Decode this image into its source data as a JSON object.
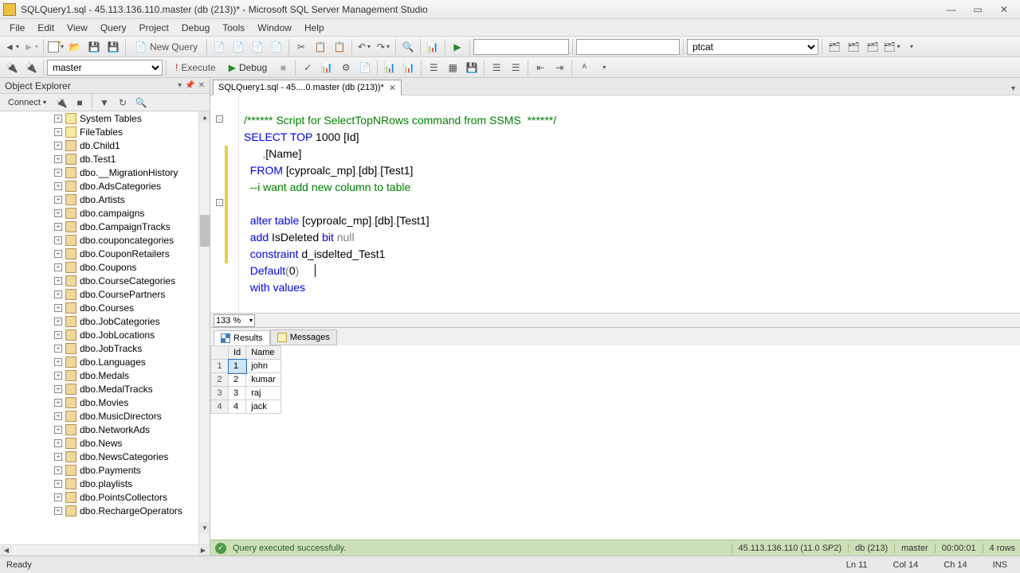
{
  "window": {
    "title": "SQLQuery1.sql - 45.113.136.110.master (db (213))* - Microsoft SQL Server Management Studio"
  },
  "menu": [
    "File",
    "Edit",
    "View",
    "Query",
    "Project",
    "Debug",
    "Tools",
    "Window",
    "Help"
  ],
  "toolbar1": {
    "new_query": "New Query",
    "combo_user": "ptcat"
  },
  "toolbar2": {
    "db_selector": "master",
    "execute": "Execute",
    "debug": "Debug"
  },
  "object_explorer": {
    "title": "Object Explorer",
    "connect": "Connect",
    "nodes": [
      {
        "t": "folder",
        "label": "System Tables"
      },
      {
        "t": "folder",
        "label": "FileTables"
      },
      {
        "t": "table",
        "label": "db.Child1"
      },
      {
        "t": "table",
        "label": "db.Test1"
      },
      {
        "t": "table",
        "label": "dbo.__MigrationHistory"
      },
      {
        "t": "table",
        "label": "dbo.AdsCategories"
      },
      {
        "t": "table",
        "label": "dbo.Artists"
      },
      {
        "t": "table",
        "label": "dbo.campaigns"
      },
      {
        "t": "table",
        "label": "dbo.CampaignTracks"
      },
      {
        "t": "table",
        "label": "dbo.couponcategories"
      },
      {
        "t": "table",
        "label": "dbo.CouponRetailers"
      },
      {
        "t": "table",
        "label": "dbo.Coupons"
      },
      {
        "t": "table",
        "label": "dbo.CourseCategories"
      },
      {
        "t": "table",
        "label": "dbo.CoursePartners"
      },
      {
        "t": "table",
        "label": "dbo.Courses"
      },
      {
        "t": "table",
        "label": "dbo.JobCategories"
      },
      {
        "t": "table",
        "label": "dbo.JobLocations"
      },
      {
        "t": "table",
        "label": "dbo.JobTracks"
      },
      {
        "t": "table",
        "label": "dbo.Languages"
      },
      {
        "t": "table",
        "label": "dbo.Medals"
      },
      {
        "t": "table",
        "label": "dbo.MedalTracks"
      },
      {
        "t": "table",
        "label": "dbo.Movies"
      },
      {
        "t": "table",
        "label": "dbo.MusicDirectors"
      },
      {
        "t": "table",
        "label": "dbo.NetworkAds"
      },
      {
        "t": "table",
        "label": "dbo.News"
      },
      {
        "t": "table",
        "label": "dbo.NewsCategories"
      },
      {
        "t": "table",
        "label": "dbo.Payments"
      },
      {
        "t": "table",
        "label": "dbo.playlists"
      },
      {
        "t": "table",
        "label": "dbo.PointsCollectors"
      },
      {
        "t": "table",
        "label": "dbo.RechargeOperators"
      }
    ]
  },
  "tab": {
    "label": "SQLQuery1.sql - 45....0.master (db (213))*"
  },
  "sql": {
    "l1": "/****** Script for SelectTopNRows command from SSMS  ******/",
    "l2a": "SELECT",
    "l2b": "TOP",
    "l2c": "1000",
    "l2d": "[Id]",
    "l3a": ",",
    "l3b": "[Name]",
    "l4a": "FROM",
    "l4b": "[cyproalc_mp]",
    "l4c": ".",
    "l4d": "[db]",
    "l4e": ".",
    "l4f": "[Test1]",
    "l5": "--i want add new column to table",
    "l7a": "alter",
    "l7b": "table",
    "l7c": "[cyproalc_mp]",
    "l7d": ".",
    "l7e": "[db]",
    "l7f": ".",
    "l7g": "[Test1]",
    "l8a": "add",
    "l8b": "IsDeleted",
    "l8c": "bit",
    "l8d": "null",
    "l9a": "constraint",
    "l9b": "d_isdelted_Test1",
    "l10a": "Default",
    "l10b": "(",
    "l10c": "0",
    "l10d": ")",
    "l11a": "with",
    "l11b": "values"
  },
  "zoom": "133 %",
  "results": {
    "tab_results": "Results",
    "tab_messages": "Messages",
    "cols": [
      "Id",
      "Name"
    ],
    "rows": [
      {
        "n": "1",
        "Id": "1",
        "Name": "john"
      },
      {
        "n": "2",
        "Id": "2",
        "Name": "kumar"
      },
      {
        "n": "3",
        "Id": "3",
        "Name": "raj"
      },
      {
        "n": "4",
        "Id": "4",
        "Name": "jack"
      }
    ],
    "status": "Query executed successfully.",
    "server": "45.113.136.110 (11.0 SP2)",
    "user": "db (213)",
    "db": "master",
    "time": "00:00:01",
    "rowcount": "4 rows"
  },
  "statusbar": {
    "ready": "Ready",
    "ln": "Ln 11",
    "col": "Col 14",
    "ch": "Ch 14",
    "ins": "INS"
  }
}
